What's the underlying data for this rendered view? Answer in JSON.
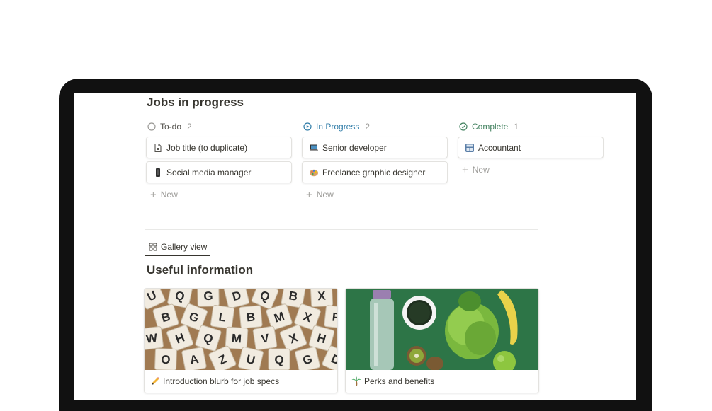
{
  "board": {
    "title": "Jobs in progress",
    "new_label": "New",
    "columns": [
      {
        "name": "To-do",
        "count": "2",
        "status_icon": "circle-outline-icon",
        "color": "#55534e",
        "cards": [
          {
            "title": "Job title (to duplicate)",
            "icon": "document-icon"
          },
          {
            "title": "Social media manager",
            "icon": "mobile-phone-icon"
          }
        ]
      },
      {
        "name": "In Progress",
        "count": "2",
        "status_icon": "play-circle-icon",
        "color": "#337ea9",
        "cards": [
          {
            "title": "Senior developer",
            "icon": "laptop-icon"
          },
          {
            "title": "Freelance graphic designer",
            "icon": "palette-icon"
          }
        ]
      },
      {
        "name": "Complete",
        "count": "1",
        "status_icon": "check-circle-icon",
        "color": "#448361",
        "cards": [
          {
            "title": "Accountant",
            "icon": "abacus-icon"
          }
        ]
      }
    ]
  },
  "gallery": {
    "tab_label": "Gallery view",
    "tab_icon": "grid-icon",
    "title": "Useful information",
    "cards": [
      {
        "title": "Introduction blurb for job specs",
        "icon": "pencil-icon",
        "cover": "scrabble-letter-tiles"
      },
      {
        "title": "Perks and benefits",
        "icon": "palm-tree-icon",
        "cover": "fruit-and-water-bottle-on-green"
      }
    ]
  },
  "colors": {
    "background": "#ffffff",
    "laptop_frame": "#111111",
    "text": "#37352f",
    "muted": "#9b9a97",
    "in_progress": "#337ea9",
    "complete": "#448361"
  }
}
